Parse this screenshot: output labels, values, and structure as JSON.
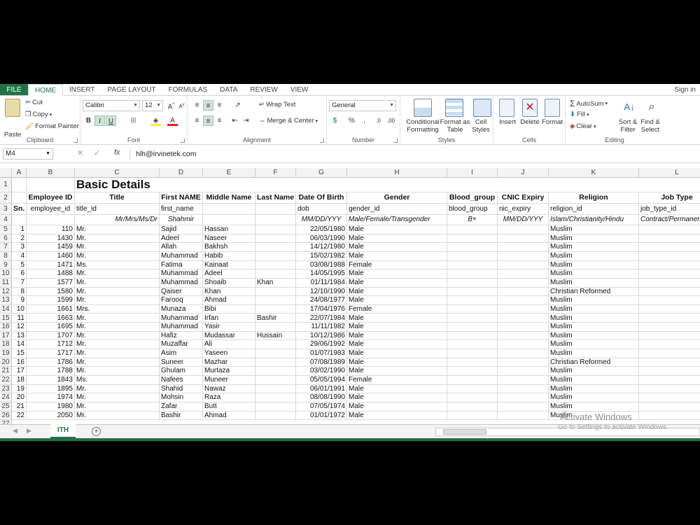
{
  "tabs": [
    "FILE",
    "HOME",
    "INSERT",
    "PAGE LAYOUT",
    "FORMULAS",
    "DATA",
    "REVIEW",
    "VIEW"
  ],
  "signin": "Sign in",
  "ribbon": {
    "clipboard": {
      "paste": "Paste",
      "cut": "Cut",
      "copy": "Copy",
      "format_painter": "Format Painter",
      "label": "Clipboard"
    },
    "font": {
      "name": "Calibri",
      "size": "12",
      "bold": "B",
      "italic": "I",
      "underline": "U",
      "font_color_glyph": "A",
      "label": "Font"
    },
    "alignment": {
      "wrap": "Wrap Text",
      "merge": "Merge & Center",
      "label": "Alignment"
    },
    "number": {
      "format": "General",
      "label": "Number"
    },
    "styles": {
      "conditional": "Conditional\nFormatting",
      "format_table": "Format as\nTable",
      "cell_styles": "Cell\nStyles",
      "label": "Styles"
    },
    "cells": {
      "insert": "Insert",
      "delete": "Delete",
      "format": "Format",
      "label": "Cells"
    },
    "editing": {
      "autosum": "AutoSum",
      "fill": "Fill",
      "clear": "Clear",
      "sort": "Sort &\nFilter",
      "find": "Find &\nSelect",
      "label": "Editing"
    }
  },
  "formula_bar": {
    "cell_ref": "M4",
    "fx": "fx",
    "content": "hlh@irvinetek.com"
  },
  "columns": [
    "A",
    "B",
    "C",
    "D",
    "E",
    "F",
    "G",
    "H",
    "I",
    "J",
    "K",
    "L"
  ],
  "row_numbers": [
    1,
    2,
    3,
    4,
    5,
    6,
    7,
    8,
    9,
    10,
    11,
    12,
    13,
    14,
    15,
    16,
    17,
    18,
    19,
    20,
    21,
    22,
    23,
    24,
    25,
    26,
    27
  ],
  "title": "Basic Details",
  "headers": [
    "Employee ID",
    "Title",
    "First NAME",
    "Middle Name",
    "Last Name",
    "Date Of Birth",
    "Gender",
    "Blood_group",
    "CNIC Expiry",
    "Religion",
    "Job Type"
  ],
  "row3": [
    "Sn.",
    "employee_id",
    "title_id",
    "first_name",
    "",
    "",
    "dob",
    "gender_id",
    "blood_group",
    "nic_expiry",
    "religion_id",
    "job_type_id"
  ],
  "row4": [
    "",
    "",
    "Mr/Mrs/Ms/Dr",
    "Shahmir",
    "",
    "",
    "MM/DD/YYY",
    "Male/Female/Transgender",
    "B+",
    "MM/DD/YYY",
    "Islam/Christianity/Hindu",
    "Contract/Permanent"
  ],
  "rows": [
    [
      "1",
      "110",
      "Mr.",
      "Sajid",
      "Hassan",
      "",
      "22/05/1980",
      "Male",
      "",
      "",
      "Muslim",
      ""
    ],
    [
      "2",
      "1430",
      "Mr.",
      "Adeel",
      "Naseer",
      "",
      "06/03/1990",
      "Male",
      "",
      "",
      "Muslim",
      ""
    ],
    [
      "3",
      "1459",
      "Mr.",
      "Allah",
      "Bakhsh",
      "",
      "14/12/1980",
      "Male",
      "",
      "",
      "Muslim",
      ""
    ],
    [
      "4",
      "1460",
      "Mr.",
      "Muhammad",
      "Habib",
      "",
      "15/02/1982",
      "Male",
      "",
      "",
      "Muslim",
      ""
    ],
    [
      "5",
      "1471",
      "Ms.",
      "Fatima",
      "Kainaat",
      "",
      "03/08/1988",
      "Female",
      "",
      "",
      "Muslim",
      ""
    ],
    [
      "6",
      "1488",
      "Mr.",
      "Muhammad",
      "Adeel",
      "",
      "14/05/1995",
      "Male",
      "",
      "",
      "Muslim",
      ""
    ],
    [
      "7",
      "1577",
      "Mr.",
      "Muhammad",
      "Shoaib",
      "Khan",
      "01/11/1984",
      "Male",
      "",
      "",
      "Muslim",
      ""
    ],
    [
      "8",
      "1580",
      "Mr.",
      "Qaiser",
      "Khan",
      "",
      "12/10/1990",
      "Male",
      "",
      "",
      "Christian Reformed",
      ""
    ],
    [
      "9",
      "1599",
      "Mr.",
      "Farooq",
      "Ahmad",
      "",
      "24/08/1977",
      "Male",
      "",
      "",
      "Muslim",
      ""
    ],
    [
      "10",
      "1661",
      "Mrs.",
      "Munaza",
      "Bibi",
      "",
      "17/04/1976",
      "Female",
      "",
      "",
      "Muslim",
      ""
    ],
    [
      "11",
      "1663",
      "Mr.",
      "Muhammad",
      "Irfan",
      "Bashir",
      "22/07/1984",
      "Male",
      "",
      "",
      "Muslim",
      ""
    ],
    [
      "12",
      "1695",
      "Mr.",
      "Muhammad",
      "Yasir",
      "",
      "11/11/1982",
      "Male",
      "",
      "",
      "Muslim",
      ""
    ],
    [
      "13",
      "1707",
      "Mr.",
      "Hafiz",
      "Mudassar",
      "Hussain",
      "10/12/1986",
      "Male",
      "",
      "",
      "Muslim",
      ""
    ],
    [
      "14",
      "1712",
      "Mr.",
      "Muzaffar",
      "Ali",
      "",
      "29/06/1992",
      "Male",
      "",
      "",
      "Muslim",
      ""
    ],
    [
      "15",
      "1717",
      "Mr.",
      "Asim",
      "Yaseen",
      "",
      "01/07/1983",
      "Male",
      "",
      "",
      "Muslim",
      ""
    ],
    [
      "16",
      "1786",
      "Mr.",
      "Suneer",
      "Mazhar",
      "",
      "07/08/1989",
      "Male",
      "",
      "",
      "Christian Reformed",
      ""
    ],
    [
      "17",
      "1788",
      "Mr.",
      "Ghulam",
      "Murtaza",
      "",
      "03/02/1990",
      "Male",
      "",
      "",
      "Muslim",
      ""
    ],
    [
      "18",
      "1843",
      "Ms.",
      "Nafees",
      "Muneer",
      "",
      "05/05/1994",
      "Female",
      "",
      "",
      "Muslim",
      ""
    ],
    [
      "19",
      "1895",
      "Mr.",
      "Shahid",
      "Nawaz",
      "",
      "06/01/1991",
      "Male",
      "",
      "",
      "Muslim",
      ""
    ],
    [
      "20",
      "1974",
      "Mr.",
      "Mohsin",
      "Raza",
      "",
      "08/08/1990",
      "Male",
      "",
      "",
      "Muslim",
      ""
    ],
    [
      "21",
      "1980",
      "Mr.",
      "Zafar",
      "Butt",
      "",
      "07/05/1974",
      "Male",
      "",
      "",
      "Muslim",
      ""
    ],
    [
      "22",
      "2050",
      "Mr.",
      "Bashir",
      "Ahmad",
      "",
      "01/01/1972",
      "Male",
      "",
      "",
      "Muslim",
      ""
    ]
  ],
  "sheet_tab": "ITH",
  "add_sheet": "+",
  "watermark": {
    "line1": "Activate Windows",
    "line2": "Go to Settings to activate Windows."
  },
  "colors": {
    "accent": "#217346"
  }
}
